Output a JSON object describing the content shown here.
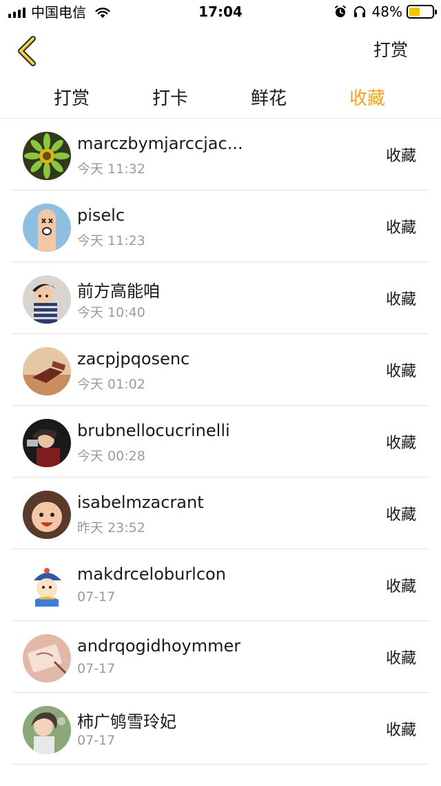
{
  "status_bar": {
    "carrier": "中国电信",
    "time": "17:04",
    "battery_percent": "48%",
    "battery_level": 0.48,
    "battery_color": "#f7c200"
  },
  "nav": {
    "back_icon": "chevron-left-icon",
    "right_action": "打赏"
  },
  "tabs": [
    {
      "label": "打赏",
      "active": false
    },
    {
      "label": "打卡",
      "active": false
    },
    {
      "label": "鲜花",
      "active": false
    },
    {
      "label": "收藏",
      "active": true
    }
  ],
  "accent_color": "#f2a21e",
  "list": [
    {
      "name": "marczbymjarccjac...",
      "time": "今天 11:32",
      "action": "收藏",
      "avatar": "sunflower-avatar"
    },
    {
      "name": "piselc",
      "time": "今天 11:23",
      "action": "收藏",
      "avatar": "finger-face-avatar"
    },
    {
      "name": "前方高能咱",
      "time": "今天 10:40",
      "action": "收藏",
      "avatar": "cartoon-child-avatar"
    },
    {
      "name": "zacpjpqosenc",
      "time": "今天 01:02",
      "action": "收藏",
      "avatar": "photo-avatar"
    },
    {
      "name": "brubnellocucrinelli",
      "time": "今天 00:28",
      "action": "收藏",
      "avatar": "photo-avatar"
    },
    {
      "name": "isabelmzacrant",
      "time": "昨天 23:52",
      "action": "收藏",
      "avatar": "smiling-girl-avatar"
    },
    {
      "name": "makdrceloburlcon",
      "time": "07-17",
      "action": "收藏",
      "avatar": "cartoon-character-avatar"
    },
    {
      "name": "andrqogidhoymmer",
      "time": "07-17",
      "action": "收藏",
      "avatar": "photo-avatar"
    },
    {
      "name": "柿广鸲雪玲妃",
      "time": "07-17",
      "action": "收藏",
      "avatar": "photo-avatar"
    }
  ]
}
